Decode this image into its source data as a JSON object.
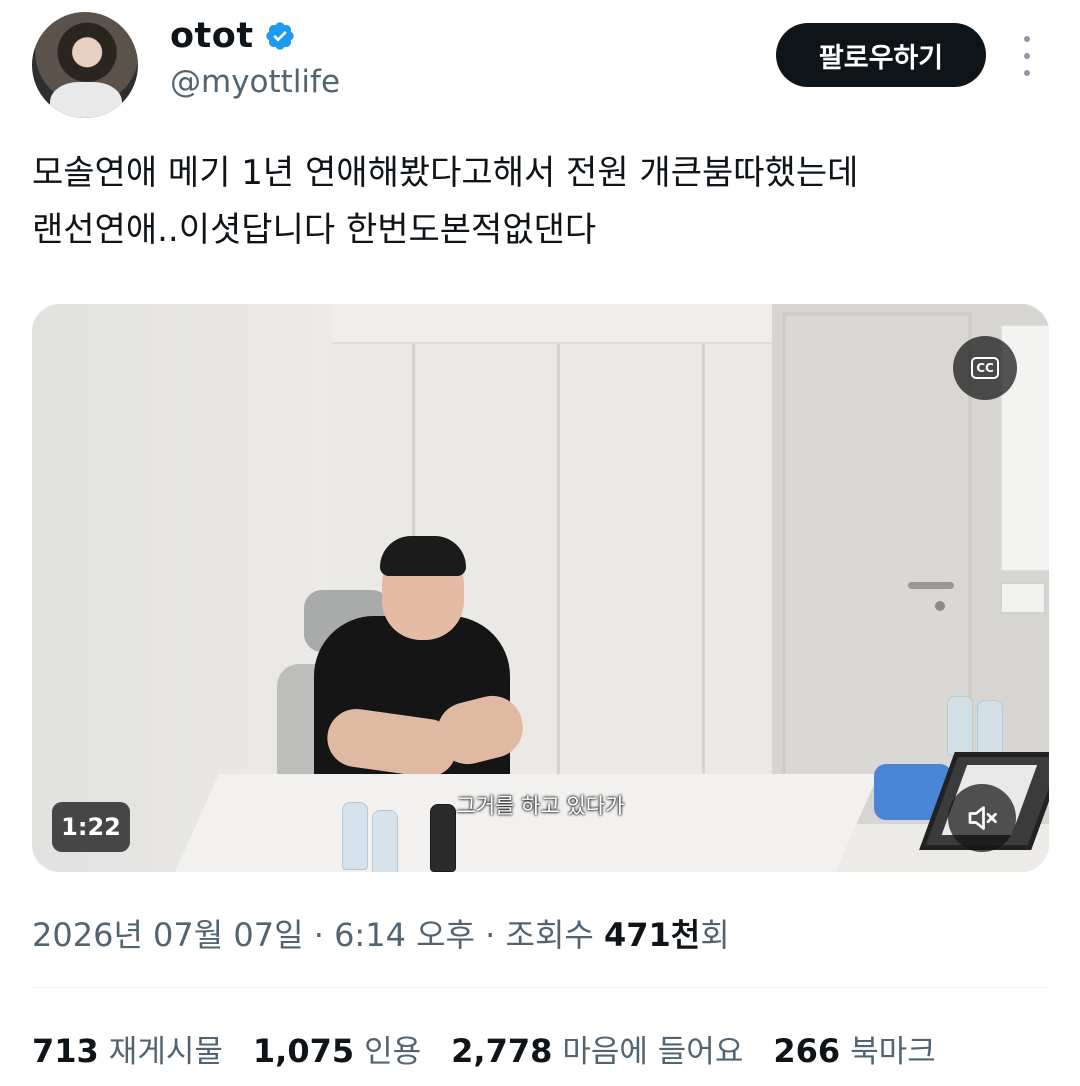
{
  "user": {
    "display_name": "otot",
    "handle": "@myottlife",
    "verified_icon": "verified-badge-icon",
    "accent": "#1d9bf0"
  },
  "header": {
    "follow_label": "팔로우하기",
    "more_icon": "more-vertical-icon"
  },
  "tweet": {
    "line1": "모솔연애 메기 1년 연애해봤다고해서 전원 개큰붐따했는데",
    "line2": "랜선연애..이셧답니다 한번도본적없댄다"
  },
  "video": {
    "cc_label": "CC",
    "subtitle": "그거를 하고 있다가",
    "duration": "1:22",
    "mute_icon": "volume-muted-icon"
  },
  "meta": {
    "date": "2026년 07월 07일",
    "sep1": " · ",
    "time": "6:14 오후",
    "sep2": " · ",
    "views_prefix": "조회수 ",
    "views_count": "471천",
    "views_suffix": "회"
  },
  "stats": [
    {
      "count": "713",
      "label": "재게시물"
    },
    {
      "count": "1,075",
      "label": "인용"
    },
    {
      "count": "2,778",
      "label": "마음에 들어요"
    },
    {
      "count": "266",
      "label": "북마크"
    }
  ]
}
